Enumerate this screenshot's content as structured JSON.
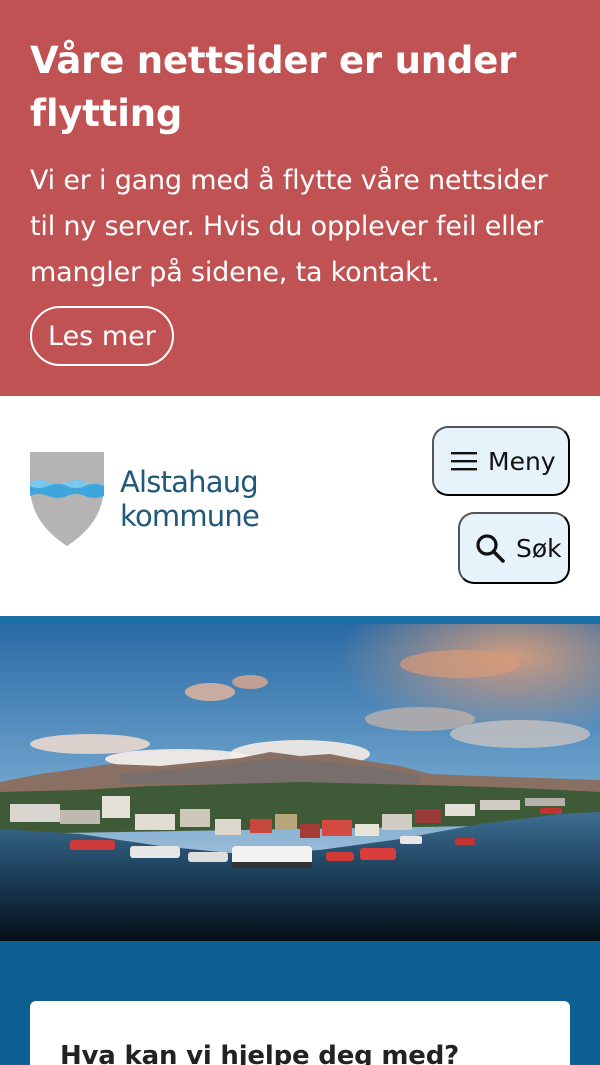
{
  "notice": {
    "title": "Våre nettsider er under flytting",
    "text": "Vi er i gang med å flytte våre nettsider til ny server. Hvis du opplever feil eller mangler på sidene, ta kontakt.",
    "button_label": "Les mer"
  },
  "header": {
    "logo_line1": "Alstahaug",
    "logo_line2": "kommune",
    "menu_label": "Meny",
    "menu_icon": "hamburger-icon",
    "search_label": "Søk",
    "search_icon": "search-icon"
  },
  "help": {
    "title": "Hva kan vi hjelpe deg med?"
  },
  "colors": {
    "notice_bg": "#c05253",
    "brand_text": "#1f5878",
    "header_button_bg": "#e7f3fb",
    "help_bg": "#0d5f91"
  }
}
